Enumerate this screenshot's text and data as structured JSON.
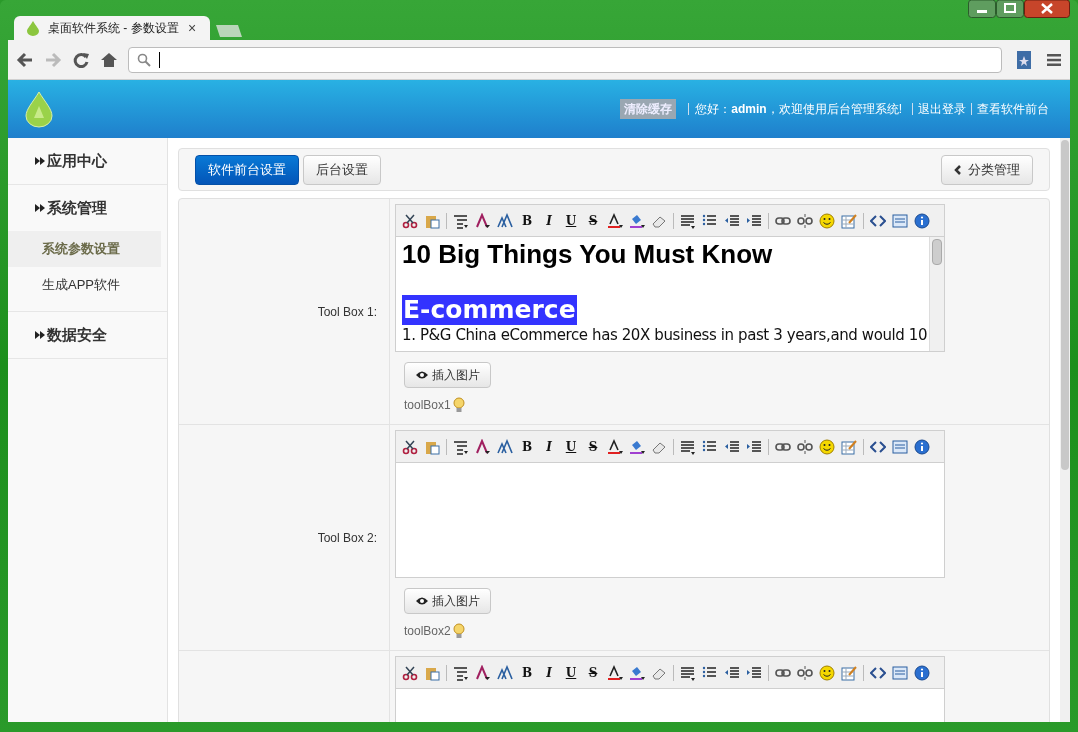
{
  "browser": {
    "tab_title": "桌面软件系统 - 参数设置",
    "tab_close": "×"
  },
  "header": {
    "clear_cache": "清除缓存",
    "greeting": "您好：",
    "user": "admin",
    "welcome": "，欢迎使用后台管理系统!",
    "links": [
      "退出登录",
      "查看软件前台"
    ]
  },
  "sidebar": {
    "groups": [
      {
        "label": "应用中心"
      },
      {
        "label": "系统管理",
        "children": [
          {
            "label": "系统参数设置",
            "selected": true
          },
          {
            "label": "生成APP软件",
            "selected": false
          }
        ]
      },
      {
        "label": "数据安全"
      }
    ]
  },
  "tabs": [
    {
      "label": "软件前台设置",
      "selected": true
    },
    {
      "label": "后台设置",
      "selected": false
    }
  ],
  "category_button": "分类管理",
  "rows": [
    {
      "label": "Tool Box 1:",
      "format_glyphs": [
        "B",
        "I",
        "U",
        "S"
      ],
      "content": [
        {
          "kind": "heading",
          "text": "10 Big Things You Must Know"
        },
        {
          "kind": "highlight",
          "text": "E-commerce"
        },
        {
          "kind": "paragraph",
          "text": "1. P&G China eCommerce has 20X business in past 3 years,and would 10"
        }
      ],
      "insert_button": "插入图片",
      "hint": "toolBox1"
    },
    {
      "label": "Tool Box 2:",
      "format_glyphs": [
        "B",
        "I",
        "U",
        "S"
      ],
      "content": [],
      "insert_button": "插入图片",
      "hint": "toolBox2"
    },
    {
      "format_glyphs": [
        "B",
        "I",
        "U",
        "S"
      ],
      "content": []
    }
  ]
}
